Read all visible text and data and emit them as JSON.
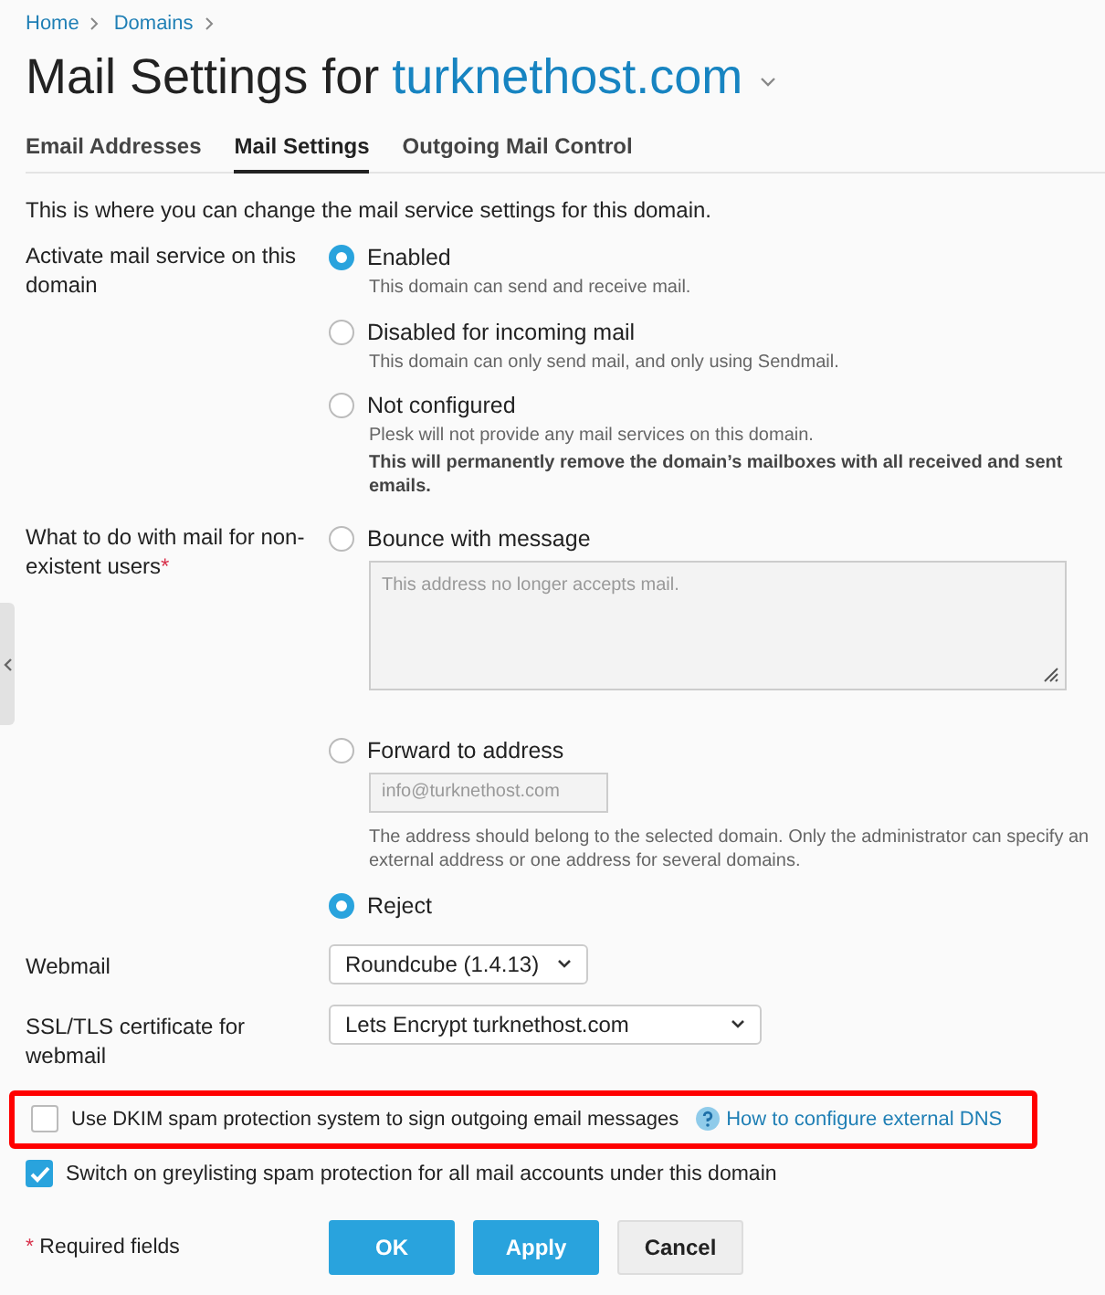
{
  "breadcrumbs": [
    {
      "label": "Home"
    },
    {
      "label": "Domains"
    }
  ],
  "title": {
    "prefix": "Mail Settings for",
    "domain": "turknethost.com"
  },
  "tabs": [
    {
      "label": "Email Addresses",
      "selected": false
    },
    {
      "label": "Mail Settings",
      "selected": true
    },
    {
      "label": "Outgoing Mail Control",
      "selected": false
    }
  ],
  "intro": "This is where you can change the mail service settings for this domain.",
  "required_mark": "*",
  "fields": [
    {
      "kind": "radio",
      "label": "Activate mail service on this domain",
      "required": false,
      "options": [
        {
          "label": "Enabled",
          "selected": true,
          "hints": [
            {
              "text": "This domain can send and receive mail.",
              "emphasis": false
            }
          ]
        },
        {
          "label": "Disabled for incoming mail",
          "selected": false,
          "hints": [
            {
              "text": "This domain can only send mail, and only using Sendmail.",
              "emphasis": false
            }
          ]
        },
        {
          "label": "Not configured",
          "selected": false,
          "hints": [
            {
              "text": "Plesk will not provide any mail services on this domain.",
              "emphasis": false
            },
            {
              "text": "This will permanently remove the domain’s mailboxes with all received and sent emails.",
              "emphasis": true
            }
          ]
        }
      ]
    },
    {
      "kind": "radio",
      "label": "What to do with mail for non-existent users",
      "required": true,
      "options": [
        {
          "label": "Bounce with message",
          "selected": false,
          "textarea": {
            "placeholder": "This address no longer accepts mail."
          }
        },
        {
          "label": "Forward to address",
          "selected": false,
          "input": {
            "placeholder": "info@turknethost.com"
          },
          "hints": [
            {
              "text": "The address should belong to the selected domain. Only the administrator can specify an external address or one address for several domains.",
              "emphasis": false
            }
          ]
        },
        {
          "label": "Reject",
          "selected": true
        }
      ]
    },
    {
      "kind": "select",
      "label": "Webmail",
      "value": "Roundcube (1.4.13)"
    },
    {
      "kind": "select",
      "label": "SSL/TLS certificate for webmail",
      "value": "Lets Encrypt turknethost.com"
    }
  ],
  "checkboxes": [
    {
      "label": "Use DKIM spam protection system to sign outgoing email messages",
      "checked": false,
      "highlighted": true,
      "help_link": "How to configure external DNS"
    },
    {
      "label": "Switch on greylisting spam protection for all mail accounts under this domain",
      "checked": true,
      "highlighted": false
    }
  ],
  "required_note": "Required fields",
  "buttons": [
    {
      "label": "OK",
      "kind": "primary"
    },
    {
      "label": "Apply",
      "kind": "primary"
    },
    {
      "label": "Cancel",
      "kind": "secondary"
    }
  ]
}
